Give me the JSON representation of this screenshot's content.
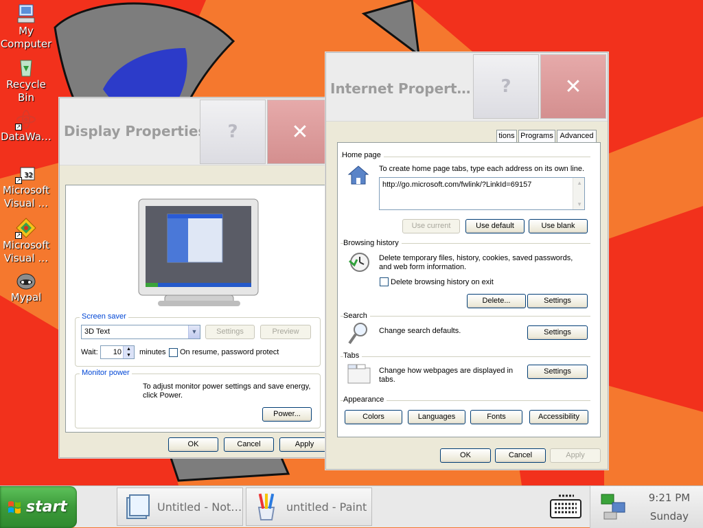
{
  "desktop_icons": [
    {
      "label_lines": [
        "My",
        "Computer"
      ],
      "icon": "my-computer-icon"
    },
    {
      "label_lines": [
        "Recycle",
        "Bin"
      ],
      "icon": "recycle-bin-icon"
    },
    {
      "label_lines": [
        "DataWa…"
      ],
      "icon": "datawa-icon"
    },
    {
      "label_lines": [
        "Microsoft",
        "Visual …"
      ],
      "icon": "visual-studio-icon"
    },
    {
      "label_lines": [
        "Microsoft",
        "Visual …"
      ],
      "icon": "visual-basic-icon"
    },
    {
      "label_lines": [
        "Mypal"
      ],
      "icon": "mypal-icon"
    }
  ],
  "display_properties": {
    "title": "Display Properties",
    "help_glyph": "?",
    "close_glyph": "✕",
    "screen_saver": {
      "legend": "Screen saver",
      "selected": "3D Text",
      "settings_label": "Settings",
      "preview_label": "Preview",
      "wait_label": "Wait:",
      "wait_value": "10",
      "minutes_label": "minutes",
      "password_label": "On resume, password protect"
    },
    "monitor_power": {
      "legend": "Monitor power",
      "description": "To adjust monitor power settings and save energy, click Power.",
      "power_label": "Power..."
    },
    "ok_label": "OK",
    "cancel_label": "Cancel",
    "apply_label": "Apply"
  },
  "internet_properties": {
    "title": "Internet Propert…",
    "help_glyph": "?",
    "close_glyph": "✕",
    "tabs": [
      "tions",
      "Programs",
      "Advanced"
    ],
    "home_page": {
      "section_label": "Home page",
      "description": "To create home page tabs, type each address on its own line.",
      "url": "http://go.microsoft.com/fwlink/?LinkId=69157",
      "use_current": "Use current",
      "use_default": "Use default",
      "use_blank": "Use blank"
    },
    "browsing_history": {
      "section_label": "Browsing history",
      "description": "Delete temporary files, history, cookies, saved passwords, and web form information.",
      "checkbox_label": "Delete browsing history on exit",
      "delete_label": "Delete...",
      "settings_label": "Settings"
    },
    "search": {
      "section_label": "Search",
      "description": "Change search defaults.",
      "settings_label": "Settings"
    },
    "tabs_section": {
      "section_label": "Tabs",
      "description": "Change how webpages are displayed in tabs.",
      "settings_label": "Settings"
    },
    "appearance": {
      "section_label": "Appearance",
      "colors": "Colors",
      "languages": "Languages",
      "fonts": "Fonts",
      "accessibility": "Accessibility"
    },
    "ok_label": "OK",
    "cancel_label": "Cancel",
    "apply_label": "Apply"
  },
  "taskbar": {
    "start_label": "start",
    "items": [
      {
        "label": "Untitled - Not…",
        "icon": "notepad-icon"
      },
      {
        "label": "untitled - Paint",
        "icon": "paint-icon"
      }
    ],
    "time": "9:21 PM",
    "day": "Sunday"
  },
  "colors": {
    "wallpaper_red": "#f2311c",
    "wallpaper_orange": "#f5782e",
    "shark_gray": "#7d7d7d",
    "start_green": "#3c9a3a",
    "xp_face": "#ece9d8",
    "legend_blue": "#0046d5"
  }
}
